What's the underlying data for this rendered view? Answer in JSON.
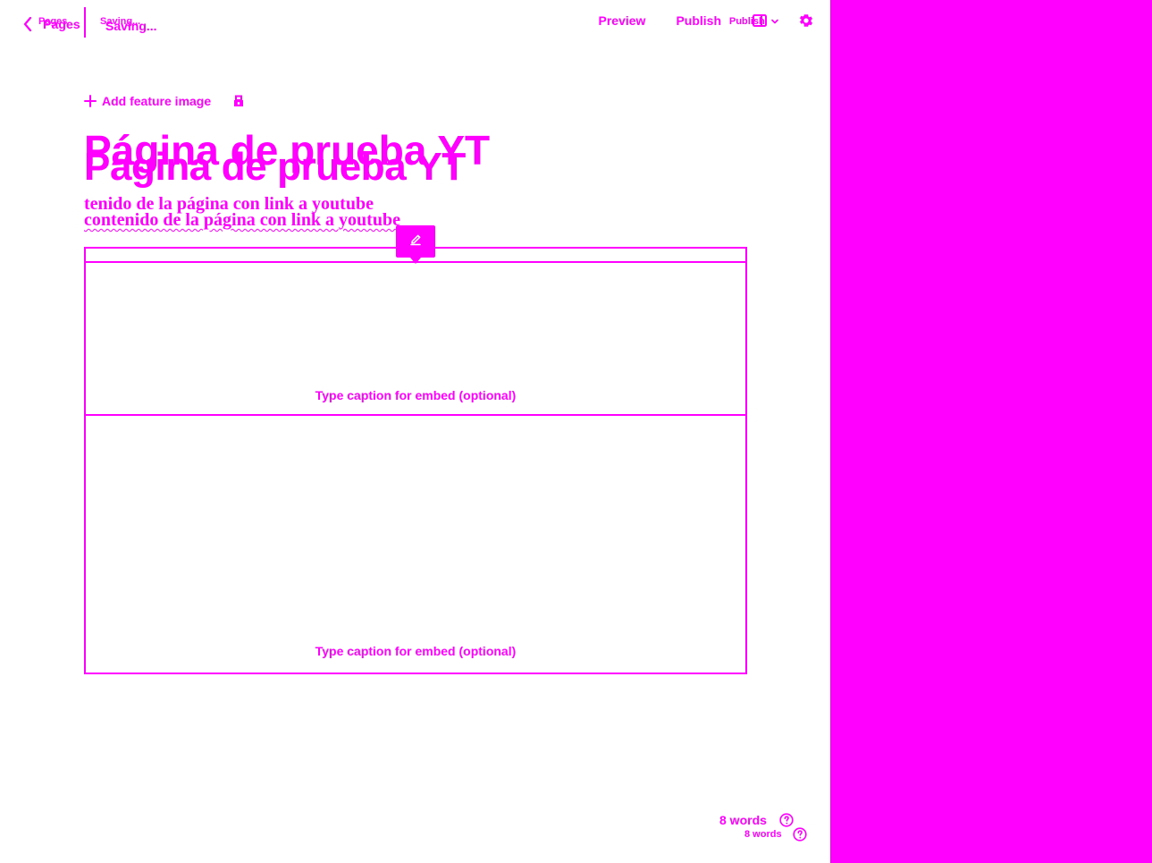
{
  "topbar": {
    "back_label": "Pages",
    "back_label_small": "Pages",
    "status": "Saving...",
    "status_small": "Saving...",
    "preview_label": "Preview",
    "publish_label": "Publish",
    "publish_label_small": "Publish"
  },
  "content": {
    "add_feature_image": "Add feature image",
    "title": "Página de prueba YT",
    "title_layer2": "Pagina de prueba YT",
    "body_line_1": "tenido de la página con link a youtube",
    "body_line_2": "contenido de la página con link a youtube"
  },
  "embeds": {
    "caption_1": "Type caption for embed (optional)",
    "caption_2": "Type caption for embed (optional)"
  },
  "footer": {
    "wordcount": "8 words",
    "wordcount_small": "8 words"
  },
  "colors": {
    "accent": "#ff00ff",
    "background": "#ffffff",
    "panel": "#ff00ff"
  },
  "icons": {
    "back": "chevron-left-icon",
    "chevron_down": "chevron-down-icon",
    "settings": "gear-icon",
    "sidebar_toggle": "sidebar-toggle-icon",
    "add": "plus-icon",
    "lock": "lock-icon",
    "edit": "edit-icon",
    "help": "help-icon"
  }
}
